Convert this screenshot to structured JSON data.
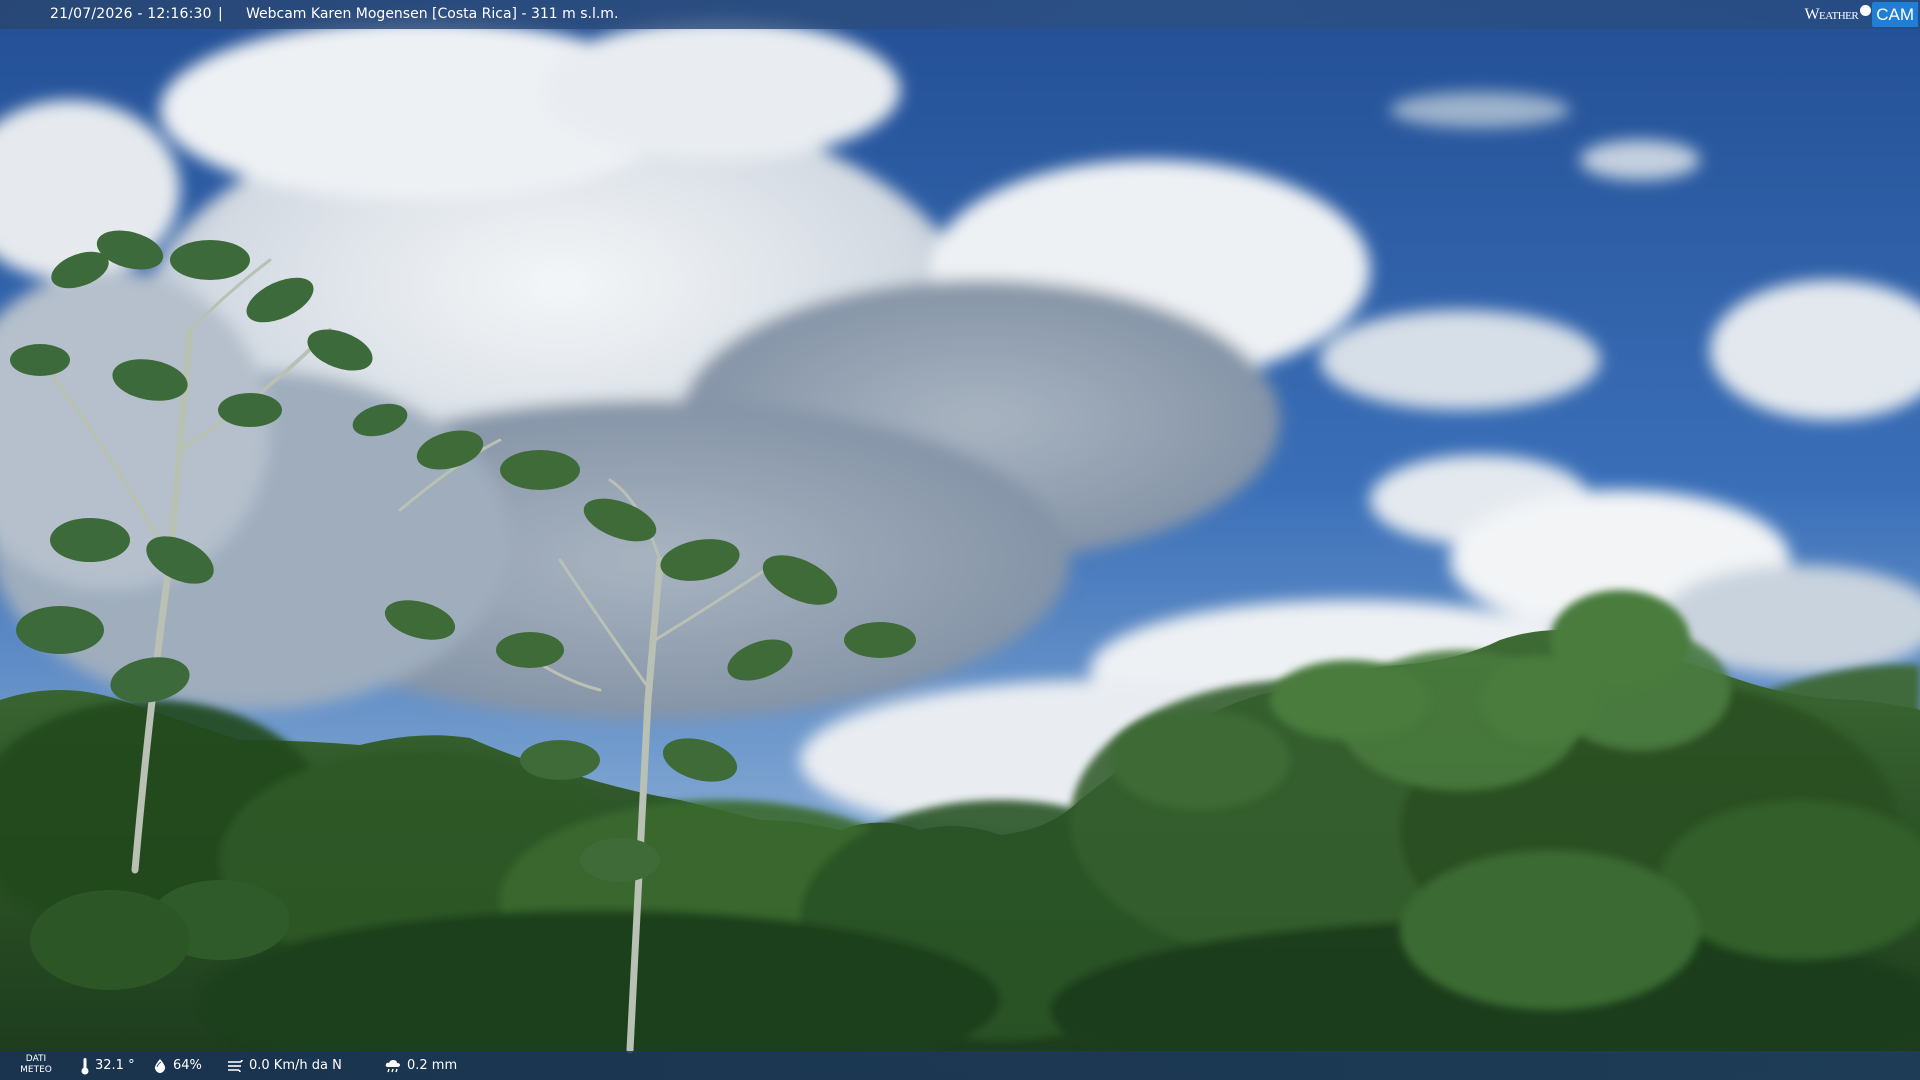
{
  "header": {
    "datetime": "21/07/2026 - 12:16:30",
    "separator": "|",
    "caption": "Webcam Karen Mogensen [Costa Rica] - 311 m s.l.m."
  },
  "logo": {
    "word1": "Weather",
    "word2": "CAM"
  },
  "weather_bar": {
    "label_line1": "DATI",
    "label_line2": "METEO",
    "temperature": "32.1 °",
    "humidity": "64%",
    "wind": "0.0 Km/h da N",
    "rain": "0.2 mm"
  },
  "icons": {
    "temperature": "thermometer-icon",
    "humidity": "drop-icon",
    "wind": "wind-icon",
    "rain": "rain-cloud-icon"
  },
  "colors": {
    "sky": "#2c5fa8",
    "cloud": "#ffffff",
    "forest": "#2f5a2a",
    "bar": "#2a4a78",
    "logo_accent": "#1f7fd6"
  }
}
